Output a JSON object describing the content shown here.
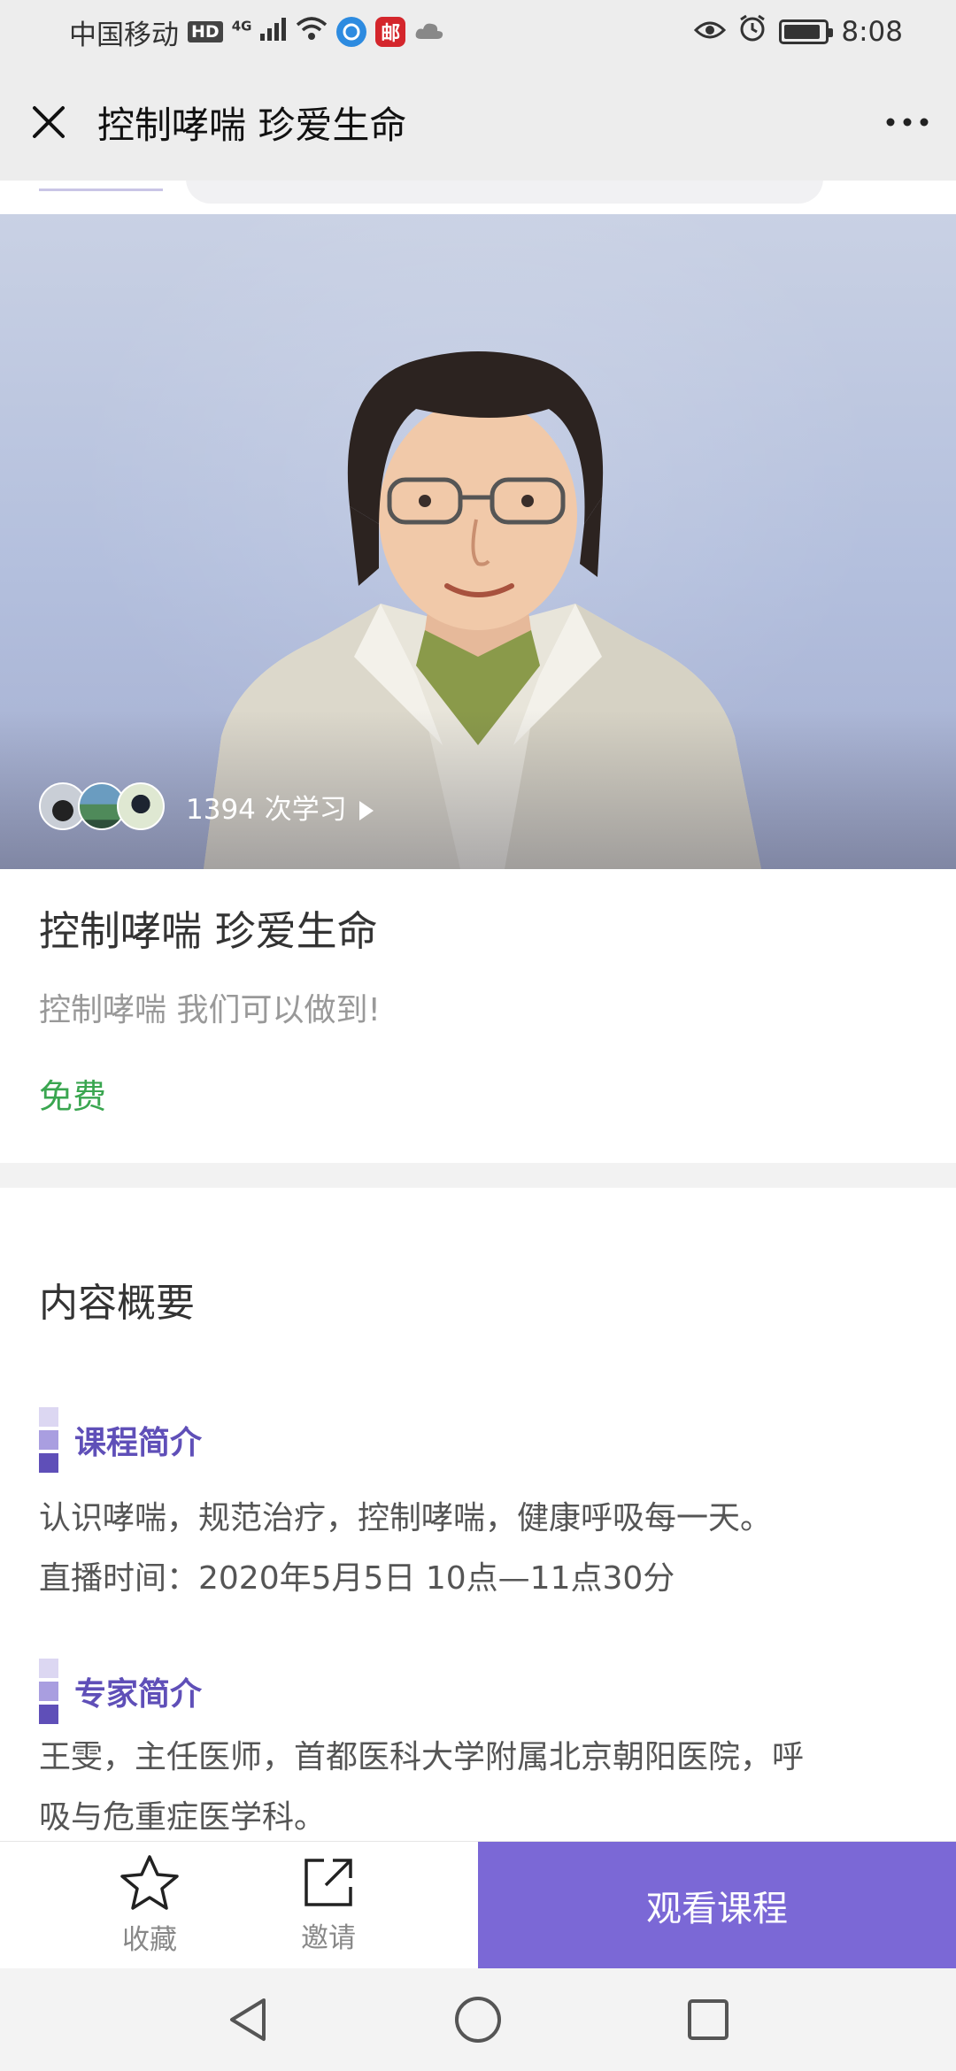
{
  "status_bar": {
    "carrier": "中国移动",
    "hd": "HD",
    "network": "4G",
    "app_badge": "邮",
    "time": "8:08"
  },
  "header": {
    "title": "控制哮喘 珍爱生命"
  },
  "hero": {
    "learners": "1394 次学习"
  },
  "course": {
    "title": "控制哮喘 珍爱生命",
    "subtitle": "控制哮喘 我们可以做到!",
    "price": "免费"
  },
  "summary": {
    "heading": "内容概要",
    "sections": [
      {
        "title": "课程简介",
        "lines": [
          "认识哮喘，规范治疗，控制哮喘，健康呼吸每一天。",
          "直播时间：2020年5月5日 10点—11点30分"
        ]
      },
      {
        "title": "专家简介",
        "lines": [
          "王雯，主任医师，首都医科大学附属北京朝阳医院，呼",
          "吸与危重症医学科。"
        ]
      }
    ]
  },
  "actions": {
    "favorite": "收藏",
    "invite": "邀请",
    "watch": "观看课程"
  },
  "icons": {
    "close": "close-icon",
    "more": "more-icon",
    "favorite": "star-icon",
    "invite": "share-icon",
    "back": "back-triangle-icon",
    "home": "home-circle-icon",
    "recents": "recents-square-icon"
  },
  "colors": {
    "accent": "#7b68d6",
    "section_title": "#5f4fb8",
    "price": "#3aa650"
  }
}
